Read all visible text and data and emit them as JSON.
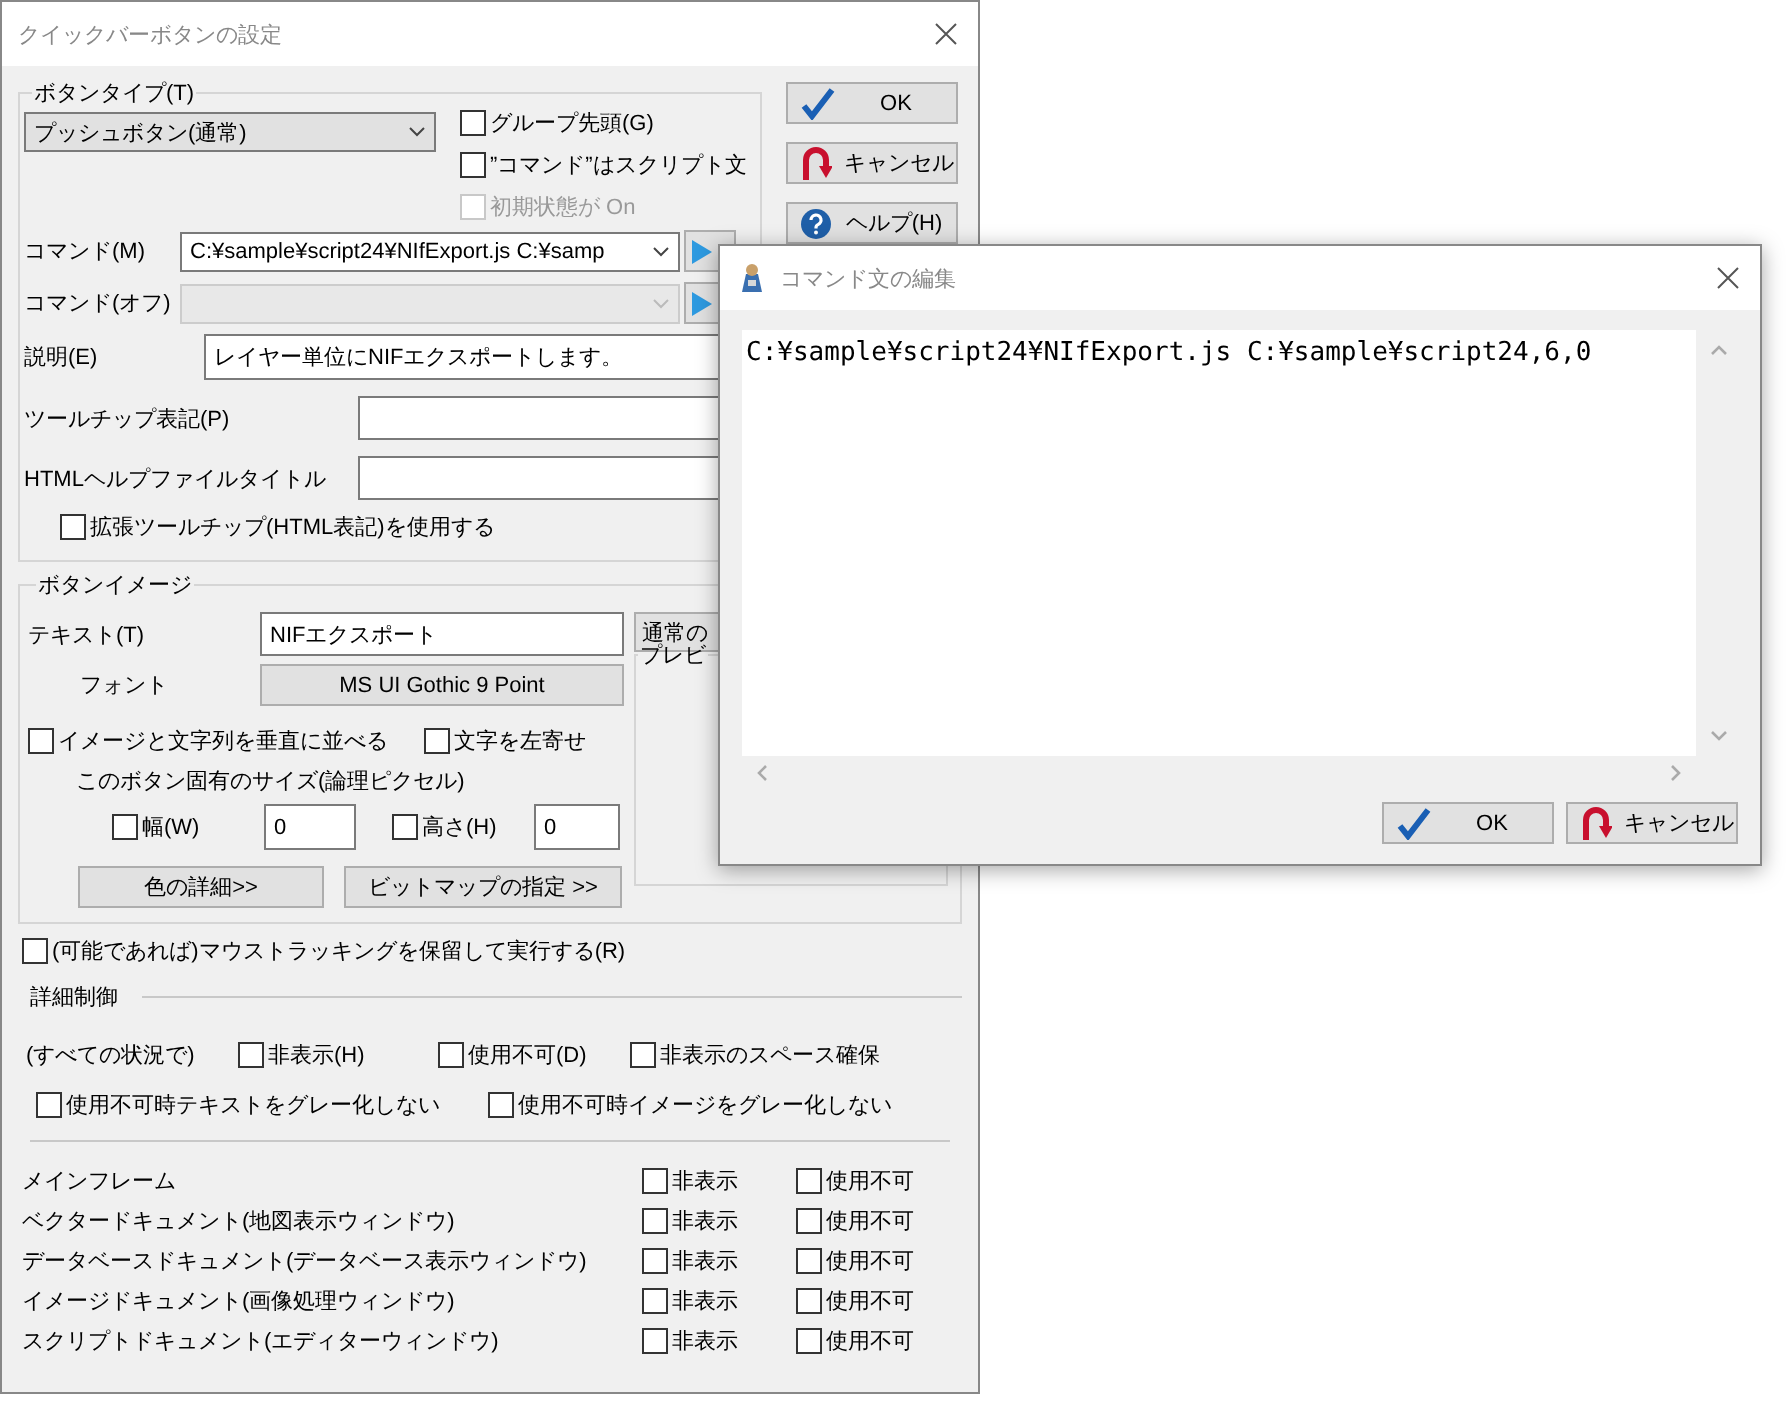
{
  "main_window": {
    "title": "クイックバーボタンの設定",
    "button_type": {
      "legend": "ボタンタイプ(T)",
      "type_select": {
        "value": "プッシュボタン(通常)"
      },
      "options": [
        {
          "label": "グループ先頭(G)",
          "checked": false,
          "disabled": false
        },
        {
          "label": "”コマンド”はスクリプト文",
          "checked": false,
          "disabled": false
        },
        {
          "label": "初期状態が On",
          "checked": false,
          "disabled": true
        }
      ],
      "command": {
        "label": "コマンド(M)",
        "value": "C:¥sample¥script24¥NIfExport.js C:¥samp",
        "disabled": false
      },
      "command_off": {
        "label": "コマンド(オフ)",
        "disabled": true
      },
      "description": {
        "label": "説明(E)",
        "value": "レイヤー単位にNIFエクスポートします。"
      },
      "tooltip": {
        "label": "ツールチップ表記(P)"
      },
      "html_help_title": {
        "label": "HTMLヘルプファイルタイトル"
      },
      "extended_tooltip": {
        "label": "拡張ツールチップ(HTML表記)を使用する",
        "checked": false
      }
    },
    "dialog_buttons": [
      {
        "kind": "ok",
        "label": "OK"
      },
      {
        "kind": "cancel",
        "label": "キャンセル"
      },
      {
        "kind": "help",
        "label": "ヘルプ(H)"
      }
    ],
    "button_image": {
      "legend": "ボタンイメージ",
      "text": {
        "label": "テキスト(T)",
        "value": "NIFエクスポート"
      },
      "normal_button": {
        "label": "通常の"
      },
      "font": {
        "label": "フォント",
        "button": "MS UI Gothic 9 Point"
      },
      "preview": {
        "legend": "プレビ"
      },
      "vertical": {
        "label": "イメージと文字列を垂直に並べる",
        "checked": false
      },
      "left_align": {
        "label": "文字を左寄せ",
        "checked": false
      },
      "size_caption": "このボタン固有のサイズ(論理ピクセル)",
      "width": {
        "label": "幅(W)",
        "checked": false,
        "value": "0"
      },
      "height": {
        "label": "高さ(H)",
        "checked": false,
        "value": "0"
      },
      "color_button": "色の詳細>>",
      "bitmap_button": "ビットマップの指定 >>"
    },
    "mouse_tracking": {
      "label": "(可能であれば)マウストラッキングを保留して実行する(R)",
      "checked": false
    },
    "detail": {
      "heading": "詳細制御",
      "all_label": "(すべての状況で)",
      "options": [
        {
          "label": "非表示(H)",
          "checked": false
        },
        {
          "label": "使用不可(D)",
          "checked": false
        },
        {
          "label": "非表示のスペース確保",
          "checked": false
        }
      ],
      "gray_options": [
        {
          "label": "使用不可時テキストをグレー化しない",
          "checked": false
        },
        {
          "label": "使用不可時イメージをグレー化しない",
          "checked": false
        }
      ],
      "rows": [
        {
          "label": "メインフレーム",
          "hidden_label": "非表示",
          "hidden": false,
          "disabled_label": "使用不可",
          "disabled": false
        },
        {
          "label": "ベクタードキュメント(地図表示ウィンドウ)",
          "hidden_label": "非表示",
          "hidden": false,
          "disabled_label": "使用不可",
          "disabled": false
        },
        {
          "label": "データベースドキュメント(データベース表示ウィンドウ)",
          "hidden_label": "非表示",
          "hidden": false,
          "disabled_label": "使用不可",
          "disabled": false
        },
        {
          "label": "イメージドキュメント(画像処理ウィンドウ)",
          "hidden_label": "非表示",
          "hidden": false,
          "disabled_label": "使用不可",
          "disabled": false
        },
        {
          "label": "スクリプトドキュメント(エディターウィンドウ)",
          "hidden_label": "非表示",
          "hidden": false,
          "disabled_label": "使用不可",
          "disabled": false
        }
      ]
    }
  },
  "command_editor": {
    "title": "コマンド文の編集",
    "text": "C:¥sample¥script24¥NIfExport.js C:¥sample¥script24,6,0",
    "buttons": [
      {
        "kind": "ok",
        "label": "OK"
      },
      {
        "kind": "cancel",
        "label": "キャンセル"
      }
    ]
  }
}
